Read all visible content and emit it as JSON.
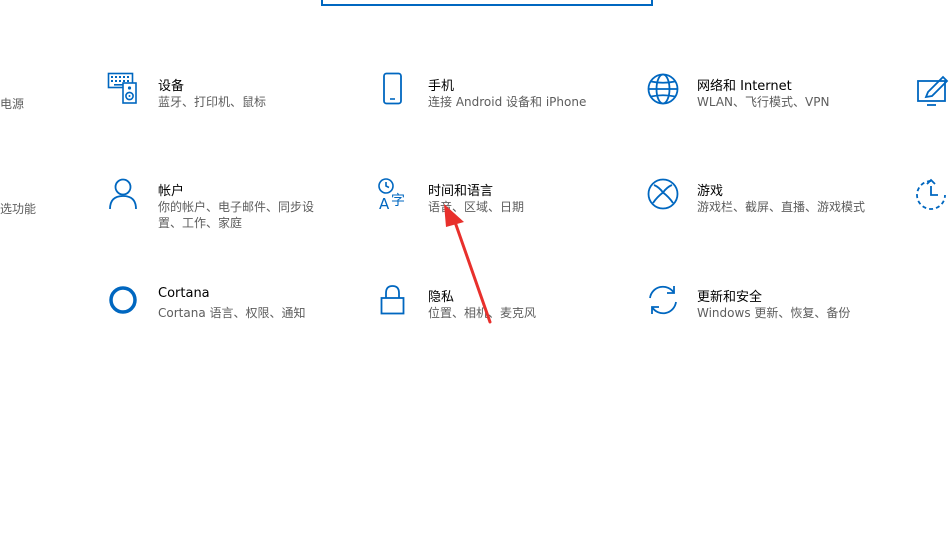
{
  "settings": {
    "partial_left": [
      {
        "desc": "电源"
      },
      {
        "desc": "选功能"
      }
    ],
    "tiles": [
      {
        "title": "设备",
        "desc": "蓝牙、打印机、鼠标",
        "icon": "keyboard-speaker-icon"
      },
      {
        "title": "手机",
        "desc": "连接 Android 设备和 iPhone",
        "icon": "phone-icon"
      },
      {
        "title": "网络和 Internet",
        "desc": "WLAN、飞行模式、VPN",
        "icon": "globe-icon"
      },
      {
        "title": "帐户",
        "desc": "你的帐户、电子邮件、同步设置、工作、家庭",
        "icon": "person-icon"
      },
      {
        "title": "时间和语言",
        "desc": "语音、区域、日期",
        "icon": "time-language-icon"
      },
      {
        "title": "游戏",
        "desc": "游戏栏、截屏、直播、游戏模式",
        "icon": "xbox-icon"
      },
      {
        "title": "Cortana",
        "desc": "Cortana 语言、权限、通知",
        "icon": "cortana-circle-icon"
      },
      {
        "title": "隐私",
        "desc": "位置、相机、麦克风",
        "icon": "lock-icon"
      },
      {
        "title": "更新和安全",
        "desc": "Windows 更新、恢复、备份",
        "icon": "sync-icon"
      }
    ],
    "partial_right": [
      {
        "icon": "display-pen-icon"
      },
      {
        "icon": "ease-of-access-clock-icon"
      }
    ]
  },
  "colors": {
    "accent": "#0067c0",
    "desc": "#5d5d5d",
    "arrow": "#e8302c"
  }
}
